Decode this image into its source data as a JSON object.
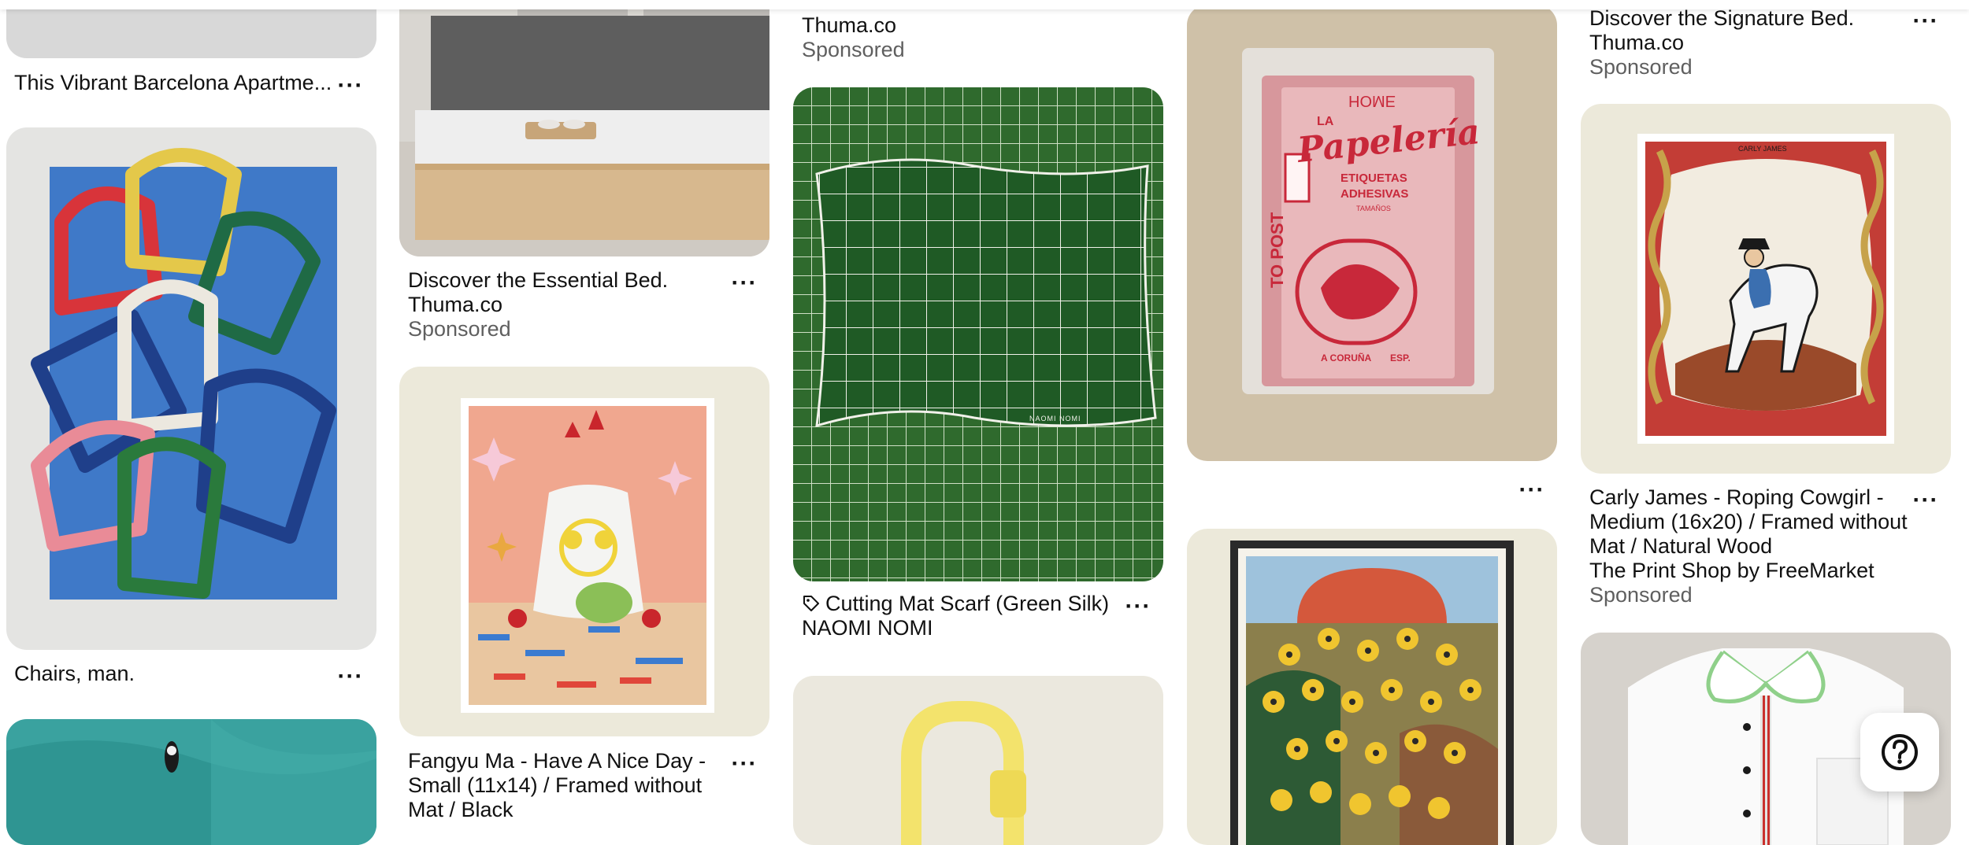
{
  "pins": {
    "barcelona": {
      "title": "This Vibrant Barcelona Apartme...",
      "more": "···"
    },
    "chairs": {
      "title": "Chairs, man.",
      "more": "···"
    },
    "essential_bed": {
      "title": "Discover the Essential Bed.",
      "advertiser": "Thuma.co",
      "sponsored": "Sponsored",
      "more": "···"
    },
    "fangyu": {
      "title": "Fangyu Ma - Have A Nice Day - Small (11x14) / Framed without Mat / Black",
      "more": "···"
    },
    "thuma_top": {
      "advertiser": "Thuma.co",
      "sponsored": "Sponsored"
    },
    "scarf": {
      "title": "Cutting Mat Scarf (Green Silk)",
      "brand": "NAOMI NOMI",
      "more": "···",
      "scarf_label": "NAOMI NOMI"
    },
    "papeleria": {
      "more": "···",
      "art_top": "HOME",
      "art_la": "LA",
      "art_brand": "Papelería",
      "art_line1": "ETIQUETAS",
      "art_line2": "ADHESIVAS",
      "art_line3": "TAMAÑOS",
      "art_side": "TO POST",
      "art_city": "A CORUÑA",
      "art_country": "ESP."
    },
    "signature_bed": {
      "title": "Discover the Signature Bed.",
      "advertiser": "Thuma.co",
      "sponsored": "Sponsored",
      "more": "···"
    },
    "cowgirl": {
      "title": "Carly James - Roping Cowgirl - Medium (16x20) / Framed without Mat / Natural Wood",
      "shop": "The Print Shop by FreeMarket",
      "sponsored": "Sponsored",
      "more": "···",
      "art_label": "CARLY JAMES"
    }
  },
  "help": {
    "icon": "question-icon"
  },
  "colors": {
    "text": "#111111",
    "muted": "#5f5f5f",
    "scarf_green": "#2f6a2d",
    "frame_cream": "#ece9da",
    "papeleria_red": "#c8283a"
  }
}
